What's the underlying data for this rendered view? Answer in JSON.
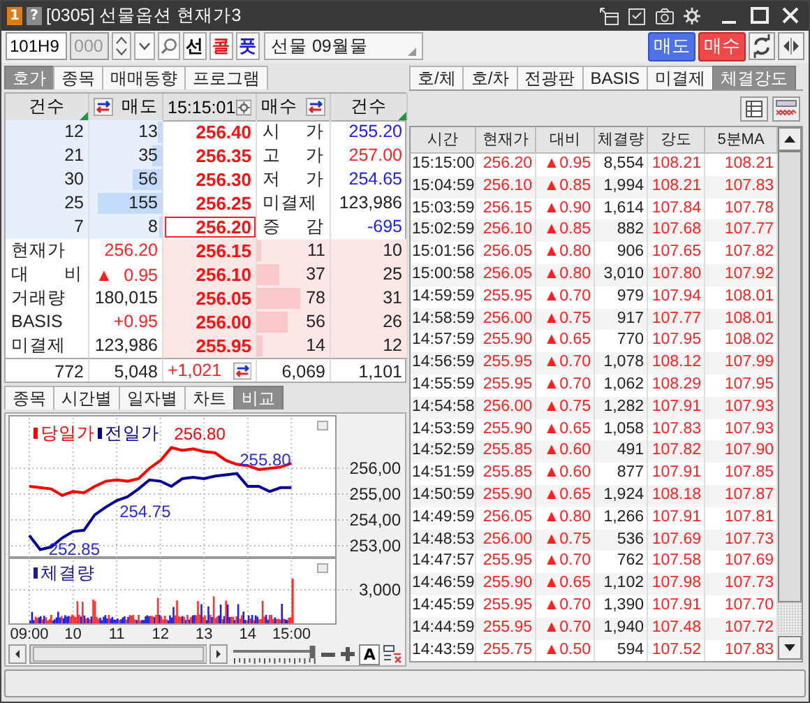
{
  "window": {
    "badge": "1",
    "help": "?",
    "title": "[0305] 선물옵션 현재가3"
  },
  "toolbar": {
    "code": "101H9",
    "sub_code": "000",
    "type_buttons": [
      {
        "label": "선",
        "color": "#000000"
      },
      {
        "label": "콜",
        "color": "#e01818"
      },
      {
        "label": "풋",
        "color": "#1a1ad0"
      }
    ],
    "name": "선물 09월물",
    "sell_button": "매도",
    "buy_button": "매수"
  },
  "left_tabs": [
    {
      "label": "호가",
      "selected": true
    },
    {
      "label": "종목",
      "selected": false
    },
    {
      "label": "매매동향",
      "selected": false
    },
    {
      "label": "프로그램",
      "selected": false
    }
  ],
  "orderbook": {
    "header": [
      "건수",
      "매도",
      "15:15:01",
      "매수",
      "건수"
    ],
    "asks": [
      {
        "count": "12",
        "qty": "13",
        "price": "256.40",
        "level": 0.05,
        "current": false
      },
      {
        "count": "21",
        "qty": "35",
        "price": "256.35",
        "level": 0.14,
        "current": false
      },
      {
        "count": "30",
        "qty": "56",
        "price": "256.30",
        "level": 0.4,
        "current": false
      },
      {
        "count": "25",
        "qty": "155",
        "price": "256.25",
        "level": 0.88,
        "current": false
      },
      {
        "count": "7",
        "qty": "8",
        "price": "256.20",
        "level": 0.03,
        "current": true
      }
    ],
    "summary": [
      {
        "label": "시 가",
        "value": "255.20",
        "color": "#1a1aff"
      },
      {
        "label": "고 가",
        "value": "257.00",
        "color": "#ff2020"
      },
      {
        "label": "저 가",
        "value": "254.65",
        "color": "#1a1aff"
      },
      {
        "label": "미결제",
        "value": "123,986",
        "color": "#202020"
      },
      {
        "label": "증 감",
        "value": "-695",
        "color": "#1a1aff"
      }
    ],
    "stats": [
      {
        "label": "현재가",
        "value": "256.20",
        "color": "#ff2020"
      },
      {
        "label": "대 비",
        "sign": "▲",
        "value": "0.95",
        "color": "#ff2020"
      },
      {
        "label": "거래량",
        "value": "180,015",
        "color": "#202020"
      },
      {
        "label": "BASIS",
        "value": "+0.95",
        "color": "#ff2020"
      },
      {
        "label": "미결제",
        "value": "123,986",
        "color": "#202020"
      }
    ],
    "bids": [
      {
        "price": "256.15",
        "qty": "11",
        "count": "10",
        "level": 0.06
      },
      {
        "price": "256.10",
        "qty": "37",
        "count": "25",
        "level": 0.3
      },
      {
        "price": "256.05",
        "qty": "78",
        "count": "31",
        "level": 0.6
      },
      {
        "price": "256.00",
        "qty": "56",
        "count": "26",
        "level": 0.42
      },
      {
        "price": "255.95",
        "qty": "14",
        "count": "12",
        "level": 0.08
      }
    ],
    "totals": {
      "ask_count": "772",
      "ask_qty": "5,048",
      "diff": "+1,021",
      "bid_qty": "6,069",
      "bid_count": "1,101"
    }
  },
  "chart_panel": {
    "tabs": [
      {
        "label": "종목",
        "selected": false
      },
      {
        "label": "시간별",
        "selected": false
      },
      {
        "label": "일자별",
        "selected": false
      },
      {
        "label": "차트",
        "selected": false
      },
      {
        "label": "비교",
        "selected": true
      }
    ],
    "chart_data": {
      "type": "line",
      "x": [
        9,
        9.25,
        9.5,
        9.75,
        10,
        10.25,
        10.5,
        10.75,
        11,
        11.25,
        11.5,
        11.75,
        12,
        12.25,
        12.5,
        12.75,
        13,
        13.25,
        13.5,
        13.75,
        14,
        14.25,
        14.5,
        14.75,
        15
      ],
      "series": [
        {
          "name": "당일가",
          "color": "#ff0000",
          "values": [
            255.3,
            255.25,
            255.2,
            254.95,
            255.1,
            255.05,
            255.3,
            255.5,
            255.55,
            255.5,
            255.6,
            256.0,
            256.3,
            256.8,
            256.7,
            256.75,
            256.65,
            256.6,
            256.3,
            256.15,
            256.1,
            255.95,
            256.0,
            256.05,
            256.2
          ]
        },
        {
          "name": "전일가",
          "color": "#000099",
          "values": [
            253.4,
            252.85,
            252.95,
            253.3,
            253.55,
            253.6,
            254.2,
            254.5,
            254.75,
            254.9,
            255.2,
            255.55,
            255.5,
            255.3,
            255.6,
            255.65,
            255.6,
            255.7,
            255.75,
            255.8,
            255.3,
            255.3,
            255.1,
            255.25,
            255.25
          ]
        }
      ],
      "grid": true,
      "legend": true,
      "xlim": [
        9,
        16
      ],
      "ylim": [
        252.7,
        257.9
      ],
      "xticks": [
        {
          "value": 9,
          "label": "09:00"
        },
        {
          "value": 10,
          "label": "10"
        },
        {
          "value": 11,
          "label": "11"
        },
        {
          "value": 12,
          "label": "12"
        },
        {
          "value": 13,
          "label": "13"
        },
        {
          "value": 14,
          "label": "14"
        },
        {
          "value": 15,
          "label": "15:00"
        }
      ],
      "yticks": [
        {
          "value": 253,
          "label": "253,00"
        },
        {
          "value": 254,
          "label": "254,00"
        },
        {
          "value": 255,
          "label": "255,00"
        },
        {
          "value": 256,
          "label": "256,00"
        }
      ],
      "annotations": [
        {
          "text": "256.80",
          "x": 12.25,
          "y": 256.8
        },
        {
          "text": "254.75",
          "x": 11,
          "y": 254.75
        },
        {
          "text": "255.80",
          "x": 13.75,
          "y": 255.8
        },
        {
          "text": "252.85",
          "x": 9.25,
          "y": 252.85
        }
      ]
    },
    "volume": {
      "legend": "체결량",
      "tick_label": "3,000"
    },
    "controls": {
      "auto_label": "A"
    }
  },
  "right_tabs": [
    {
      "label": "호/체",
      "selected": false
    },
    {
      "label": "호/차",
      "selected": false
    },
    {
      "label": "전광판",
      "selected": false
    },
    {
      "label": "BASIS",
      "selected": false
    },
    {
      "label": "미결제",
      "selected": false
    },
    {
      "label": "체결강도",
      "selected": true
    }
  ],
  "ticks_table": {
    "columns": [
      "시간",
      "현재가",
      "대비",
      "체결량",
      "강도",
      "5분MA"
    ],
    "rows": [
      [
        "15:15:00",
        "256.20",
        "▲0.95",
        "8,554",
        "108.21",
        "108.21"
      ],
      [
        "15:04:59",
        "256.10",
        "▲0.85",
        "1,994",
        "108.21",
        "107.83"
      ],
      [
        "15:03:59",
        "256.15",
        "▲0.90",
        "1,614",
        "107.84",
        "107.78"
      ],
      [
        "15:02:59",
        "256.10",
        "▲0.85",
        "882",
        "107.68",
        "107.77"
      ],
      [
        "15:01:56",
        "256.05",
        "▲0.80",
        "906",
        "107.65",
        "107.82"
      ],
      [
        "15:00:58",
        "256.05",
        "▲0.80",
        "3,010",
        "107.80",
        "107.92"
      ],
      [
        "14:59:59",
        "255.95",
        "▲0.70",
        "979",
        "107.94",
        "108.01"
      ],
      [
        "14:58:59",
        "256.00",
        "▲0.75",
        "917",
        "107.77",
        "108.01"
      ],
      [
        "14:57:59",
        "255.90",
        "▲0.65",
        "770",
        "107.95",
        "108.02"
      ],
      [
        "14:56:59",
        "255.95",
        "▲0.70",
        "1,078",
        "108.12",
        "107.99"
      ],
      [
        "14:55:59",
        "255.95",
        "▲0.70",
        "1,062",
        "108.29",
        "107.95"
      ],
      [
        "14:54:58",
        "256.00",
        "▲0.75",
        "1,282",
        "107.91",
        "107.93"
      ],
      [
        "14:53:59",
        "255.90",
        "▲0.65",
        "1,058",
        "107.83",
        "107.93"
      ],
      [
        "14:52:59",
        "255.85",
        "▲0.60",
        "491",
        "107.82",
        "107.90"
      ],
      [
        "14:51:59",
        "255.85",
        "▲0.60",
        "877",
        "107.91",
        "107.85"
      ],
      [
        "14:50:59",
        "255.90",
        "▲0.65",
        "1,924",
        "108.18",
        "107.87"
      ],
      [
        "14:49:59",
        "256.05",
        "▲0.80",
        "1,266",
        "107.91",
        "107.81"
      ],
      [
        "14:48:53",
        "256.00",
        "▲0.75",
        "536",
        "107.69",
        "107.73"
      ],
      [
        "14:47:57",
        "255.95",
        "▲0.70",
        "762",
        "107.58",
        "107.69"
      ],
      [
        "14:46:59",
        "255.90",
        "▲0.65",
        "1,102",
        "107.98",
        "107.73"
      ],
      [
        "14:45:59",
        "255.95",
        "▲0.70",
        "1,390",
        "107.91",
        "107.70"
      ],
      [
        "14:44:59",
        "255.95",
        "▲0.70",
        "1,940",
        "107.48",
        "107.72"
      ],
      [
        "14:43:59",
        "255.75",
        "▲0.50",
        "594",
        "107.52",
        "107.83"
      ]
    ]
  }
}
